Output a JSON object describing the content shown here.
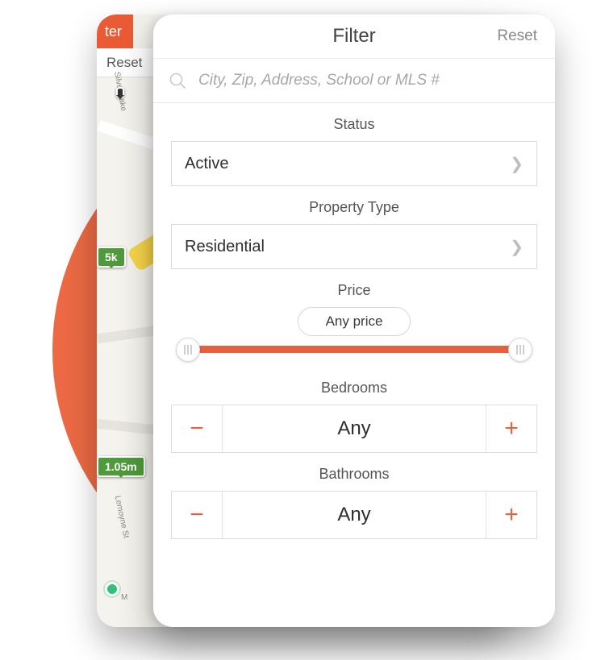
{
  "colors": {
    "accent": "#e9623e"
  },
  "backCard": {
    "filterTab": "ter",
    "reset": "Reset",
    "pins": {
      "p2": "5k",
      "p3": "1.05m"
    },
    "roads": {
      "r1": "Silver Lake",
      "r2": "Lemoyne St",
      "r3": "M"
    }
  },
  "panel": {
    "title": "Filter",
    "reset": "Reset",
    "search": {
      "placeholder": "City, Zip, Address, School or MLS #"
    },
    "status": {
      "label": "Status",
      "value": "Active"
    },
    "ptype": {
      "label": "Property Type",
      "value": "Residential"
    },
    "price": {
      "label": "Price",
      "bubble": "Any price"
    },
    "bedrooms": {
      "label": "Bedrooms",
      "value": "Any"
    },
    "bathrooms": {
      "label": "Bathrooms",
      "value": "Any"
    }
  }
}
